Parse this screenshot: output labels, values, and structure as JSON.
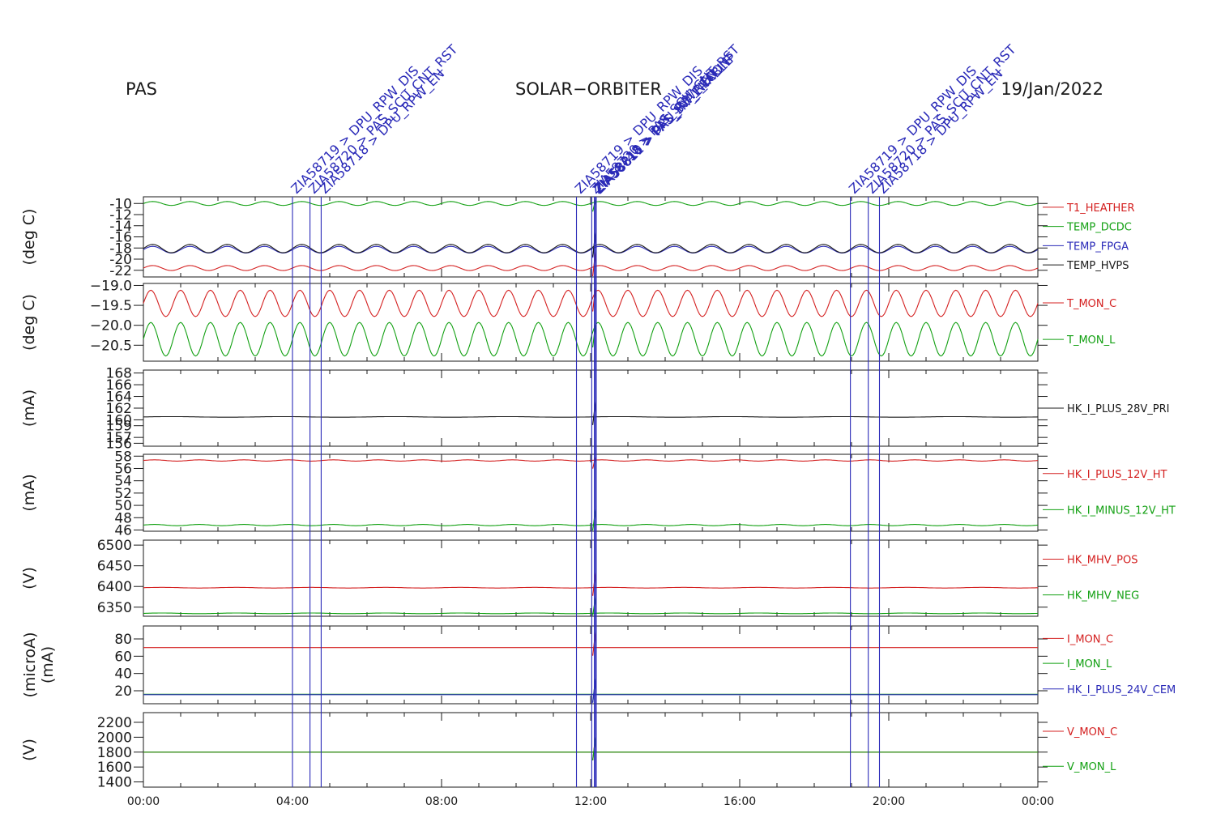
{
  "header": {
    "instrument": "PAS",
    "mission": "SOLAR−ORBITER",
    "date": "19/Jan/2022"
  },
  "colors": {
    "red": "#d42020",
    "green": "#12a012",
    "blue": "#2a2ab8",
    "black": "#1a1a1a"
  },
  "chart_data": [
    {
      "type": "line",
      "ylabel": "(deg C)",
      "yticks": [
        -10,
        -12,
        -14,
        -16,
        -18,
        -20,
        -22
      ],
      "ylim": [
        -23.2,
        -8.8
      ],
      "series": [
        {
          "name": "T1_HEATHER",
          "color": "red",
          "baseline": -21.6,
          "amp": 0.45,
          "period_h": 1.0
        },
        {
          "name": "TEMP_DCDC",
          "color": "green",
          "baseline": -10.0,
          "amp": 0.35,
          "period_h": 1.0
        },
        {
          "name": "TEMP_FPGA",
          "color": "blue",
          "baseline": -18.3,
          "amp": 0.6,
          "period_h": 1.0
        },
        {
          "name": "TEMP_HVPS",
          "color": "black",
          "baseline": -18.1,
          "amp": 0.75,
          "period_h": 1.0
        }
      ]
    },
    {
      "type": "line",
      "ylabel": "(deg C)",
      "yticks": [
        -19.0,
        -19.5,
        -20.0,
        -20.5
      ],
      "yticklabels": [
        "−19.0",
        "−19.5",
        "−20.0",
        "−20.5"
      ],
      "ylim": [
        -20.9,
        -18.95
      ],
      "series": [
        {
          "name": "T_MON_C",
          "color": "red",
          "baseline": -19.45,
          "amp": 0.33,
          "period_h": 0.8
        },
        {
          "name": "T_MON_L",
          "color": "green",
          "baseline": -20.35,
          "amp": 0.42,
          "period_h": 0.8
        }
      ]
    },
    {
      "type": "line",
      "ylabel": "(mA)",
      "yticks": [
        168,
        166,
        164,
        162,
        160,
        159,
        157,
        156
      ],
      "ylim": [
        155.5,
        168.5
      ],
      "series": [
        {
          "name": "HK_I_PLUS_28V_PRI",
          "color": "black",
          "baseline": 160.5,
          "amp": 0.05,
          "period_h": 3.0
        }
      ]
    },
    {
      "type": "line",
      "ylabel": "(mA)",
      "yticks": [
        58,
        56,
        54,
        52,
        50,
        48,
        46
      ],
      "ylim": [
        45.8,
        58.3
      ],
      "series": [
        {
          "name": "HK_I_PLUS_12V_HT",
          "color": "red",
          "baseline": 57.3,
          "amp": 0.1,
          "period_h": 1.2
        },
        {
          "name": "HK_I_MINUS_12V_HT",
          "color": "green",
          "baseline": 46.8,
          "amp": 0.1,
          "period_h": 1.2
        }
      ]
    },
    {
      "type": "line",
      "ylabel": "(V)",
      "yticks": [
        6500,
        6450,
        6400,
        6350
      ],
      "ylim": [
        6328,
        6512
      ],
      "series": [
        {
          "name": "HK_MHV_POS",
          "color": "red",
          "baseline": 6397,
          "amp": 0.8,
          "period_h": 2.0
        },
        {
          "name": "HK_MHV_NEG",
          "color": "green",
          "baseline": 6335,
          "amp": 0.8,
          "period_h": 2.0
        }
      ]
    },
    {
      "type": "line",
      "ylabel": "(microA)",
      "ylabel2": "(mA)",
      "yticks": [
        80,
        60,
        40,
        20
      ],
      "ylim": [
        5,
        95
      ],
      "series": [
        {
          "name": "I_MON_C",
          "color": "red",
          "baseline": 70,
          "amp": 0,
          "period_h": 1.0
        },
        {
          "name": "I_MON_L",
          "color": "green",
          "baseline": 16,
          "amp": 0,
          "period_h": 1.0
        },
        {
          "name": "HK_I_PLUS_24V_CEM",
          "color": "blue",
          "baseline": 15.5,
          "amp": 0,
          "period_h": 1.0
        }
      ]
    },
    {
      "type": "line",
      "ylabel": "(V)",
      "yticks": [
        2200,
        2000,
        1800,
        1600,
        1400
      ],
      "ylim": [
        1330,
        2330
      ],
      "series": [
        {
          "name": "V_MON_C",
          "color": "red",
          "baseline": 1800,
          "amp": 0,
          "period_h": 1.0
        },
        {
          "name": "V_MON_L",
          "color": "green",
          "baseline": 1800,
          "amp": 0,
          "period_h": 1.0
        }
      ]
    }
  ],
  "x_axis": {
    "range_hours": [
      0,
      24
    ],
    "ticks": [
      {
        "h": 0,
        "label": "00:00"
      },
      {
        "h": 4,
        "label": "04:00"
      },
      {
        "h": 8,
        "label": "08:00"
      },
      {
        "h": 12,
        "label": "12:00"
      },
      {
        "h": 16,
        "label": "16:00"
      },
      {
        "h": 20,
        "label": "20:00"
      },
      {
        "h": 24,
        "label": "00:00"
      }
    ]
  },
  "events": [
    {
      "h": 4.0,
      "label": "ZIA58719 > DPU_RPW_DIS"
    },
    {
      "h": 4.47,
      "label": "ZIA58720 > PAS_SCU_CNT_RST"
    },
    {
      "h": 4.77,
      "label": "ZIA58718 > DPU_RPW_EN"
    },
    {
      "h": 11.62,
      "label": "ZIA58719 > DPU_RPW_DIS"
    },
    {
      "h": 12.03,
      "label": "ZIA58720 > PAS_SCU_CNT_RST"
    },
    {
      "h": 12.1,
      "label": "ZIA58718 > DPU_RPW_EN"
    },
    {
      "h": 12.13,
      "label": "ZIA58810 > PAS_SW_RECONF"
    },
    {
      "h": 12.15,
      "label": "ZIA58811 > PAS_HV_ENABLE"
    },
    {
      "h": 18.97,
      "label": "ZIA58719 > DPU_RPW_DIS"
    },
    {
      "h": 19.45,
      "label": "ZIA58720 > PAS_SCU_CNT_RST"
    },
    {
      "h": 19.75,
      "label": "ZIA58718 > DPU_RPW_EN"
    }
  ]
}
